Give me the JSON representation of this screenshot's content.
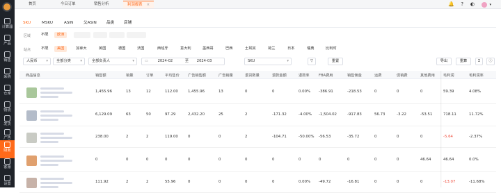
{
  "sidebar": {
    "items": [
      {
        "label": "计算器",
        "icon": "calculator-icon"
      },
      {
        "label": "产品",
        "icon": "box-icon"
      },
      {
        "label": "销售",
        "icon": "sales-icon"
      },
      {
        "label": "采购",
        "icon": "cart-icon"
      },
      {
        "label": "仓库",
        "icon": "warehouse-icon"
      },
      {
        "label": "物流",
        "icon": "truck-icon"
      },
      {
        "label": "发货",
        "icon": "ship-icon"
      },
      {
        "label": "广告",
        "icon": "ad-icon"
      },
      {
        "label": "财务",
        "icon": "finance-icon"
      },
      {
        "label": "客服",
        "icon": "support-icon"
      },
      {
        "label": "设置",
        "icon": "settings-icon"
      }
    ]
  },
  "topbar": {
    "tabs": [
      {
        "label": "首页"
      },
      {
        "label": "今日订单"
      },
      {
        "label": "销售分析"
      },
      {
        "label": "利润报表",
        "close": "×"
      }
    ]
  },
  "subtabs": [
    "SKU",
    "MSKU",
    "ASIN",
    "父ASIN",
    "品类",
    "店铺"
  ],
  "filters": {
    "region_label": "区域",
    "region": [
      "不限",
      "欧洲"
    ],
    "site_label": "站点",
    "sites": [
      "不限",
      "美国",
      "加拿大",
      "英国",
      "德国",
      "法国",
      "西班牙",
      "意大利",
      "墨西哥",
      "巴西",
      "土耳其",
      "荷兰",
      "日本",
      "瑞典",
      "比利时"
    ]
  },
  "toolbar": {
    "currency": "人民币",
    "category": "全部分类",
    "owner": "全部负责人",
    "date_start": "2024-02",
    "date_to": "至",
    "date_end": "2024-03",
    "sku_select": "SKU",
    "reset": "重置",
    "export": "导出",
    "settings": "重算",
    "sum": "Σ"
  },
  "table": {
    "headers": [
      "商品信息",
      "销售额",
      "销量",
      "订单",
      "平均售价",
      "广告销售额",
      "广告销量",
      "退货数量",
      "退款金额",
      "退款率",
      "FBA费用",
      "销售佣金",
      "运费",
      "促销费",
      "其他费用",
      "毛利润",
      "毛利润率"
    ],
    "rows": [
      [
        "1,455.96",
        "13",
        "12",
        "112.00",
        "1,455.96",
        "13",
        "0",
        "0",
        "0.00%",
        "-386.91",
        "-218.53",
        "0",
        "0",
        "0",
        "59.39",
        "4.08%"
      ],
      [
        "6,129.09",
        "63",
        "50",
        "97.29",
        "2,432.20",
        "25",
        "2",
        "-171.32",
        "-4.00%",
        "-1,504.02",
        "-917.83",
        "56.73",
        "-3.22",
        "-53.51",
        "718.11",
        "11.72%"
      ],
      [
        "238.00",
        "2",
        "2",
        "119.00",
        "0",
        "0",
        "2",
        "-104.71",
        "-50.00%",
        "-56.53",
        "-35.72",
        "0",
        "0",
        "0",
        "-5.64",
        "-2.37%"
      ],
      [
        "0",
        "0",
        "0",
        "0",
        "0",
        "0",
        "0",
        "0",
        "0",
        "0",
        "0",
        "0",
        "0",
        "46.64",
        "46.64",
        "0.0%"
      ],
      [
        "111.92",
        "2",
        "2",
        "55.96",
        "0",
        "0",
        "0",
        "0",
        "0.00%",
        "-49.72",
        "-16.81",
        "0",
        "0",
        "0",
        "-13.07",
        "-11.68%"
      ]
    ]
  },
  "colors": {
    "accent": "#ff6a1a",
    "sidebar": "#1f2329",
    "negative": "#f04b3a"
  }
}
